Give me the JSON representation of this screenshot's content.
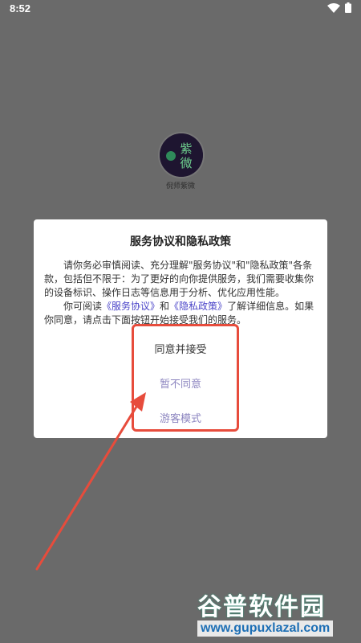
{
  "status_bar": {
    "time": "8:52"
  },
  "app": {
    "icon_text_top": "紫",
    "icon_text_bottom": "微",
    "name": "倪师紫微"
  },
  "dialog": {
    "title": "服务协议和隐私政策",
    "paragraph1": "请你务必审慎阅读、充分理解\"服务协议\"和\"隐私政策\"各条款，包括但不限于：为了更好的向你提供服务，我们需要收集你的设备标识、操作日志等信息用于分析、优化应用性能。",
    "paragraph2_prefix": "你可阅读",
    "link_service": "《服务协议》",
    "paragraph2_and": "和",
    "link_privacy": "《隐私政策》",
    "paragraph2_suffix": "了解详细信息。如果你同意，请点击下面按钮开始接受我们的服务。",
    "buttons": {
      "agree": "同意并接受",
      "disagree": "暂不同意",
      "guest": "游客模式"
    }
  },
  "watermark": {
    "main": "谷普软件园",
    "sub": "www.gupuxlazal.com"
  },
  "colors": {
    "overlay_bg": "#6a6a6a",
    "link": "#4a44c8",
    "annotation": "#e74c3c"
  }
}
